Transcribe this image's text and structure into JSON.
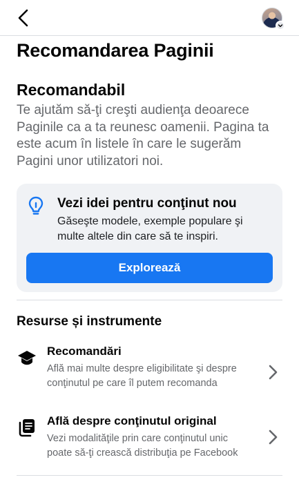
{
  "header": {
    "back_icon": "chevron-left-icon",
    "avatar_icon": "profile-avatar",
    "avatar_menu_icon": "chevron-down-icon"
  },
  "page": {
    "title": "Recomandarea Paginii"
  },
  "recommendation": {
    "status_title": "Recomandabil",
    "description": "Te ajutăm să-ţi creşti audienţa deoarece Paginile ca a ta reunesc oamenii. Pagina ta este acum în listele în care le sugerăm Pagini unor utilizatori noi."
  },
  "ideas_card": {
    "icon": "lightbulb-icon",
    "title": "Vezi idei pentru conţinut nou",
    "description": "Găseşte modele, exemple populare şi multe altele din care să te inspiri.",
    "button_label": "Explorează"
  },
  "resources": {
    "title": "Resurse și instrumente",
    "items": [
      {
        "icon": "graduation-cap-icon",
        "title": "Recomandări",
        "description": "Află mai multe despre eligibilitate şi despre conţinutul pe care îl putem recomanda"
      },
      {
        "icon": "original-content-icon",
        "title": "Află despre conţinutul original",
        "description": "Vezi modalităţile prin care conţinutul unic poate să-ţi crească distribuţia pe Facebook"
      }
    ]
  },
  "colors": {
    "accent": "#1877f2",
    "card_background": "#f0f2f5",
    "secondary_text": "#65676b",
    "divider": "#dadde1"
  }
}
